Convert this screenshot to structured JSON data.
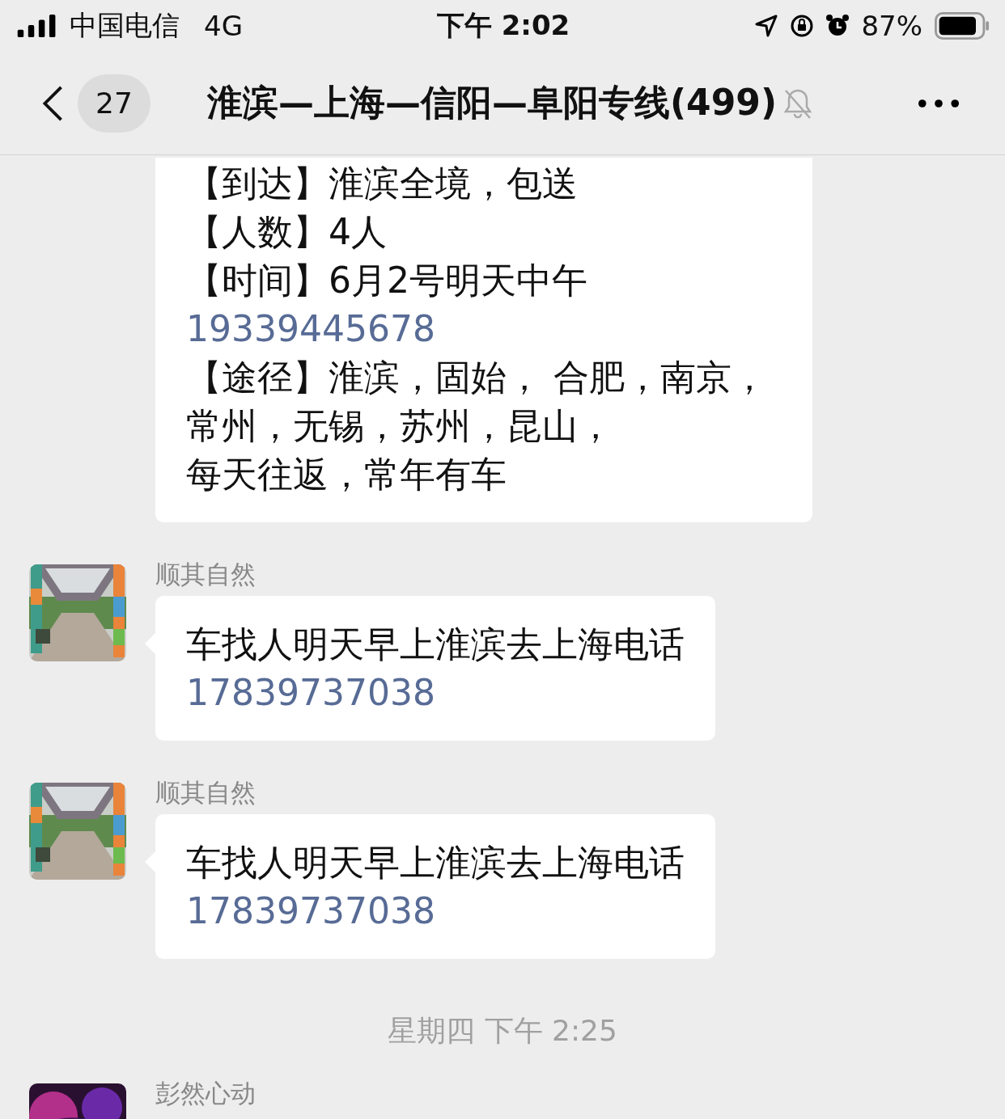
{
  "status_bar": {
    "carrier": "中国电信",
    "network": "4G",
    "time": "下午 2:02",
    "battery": "87%"
  },
  "header": {
    "back_badge": "27",
    "title": "淮滨—上海—信阳—阜阳专线(499)",
    "muted": true
  },
  "messages": [
    {
      "kind": "message",
      "lines": [
        {
          "kind": "text",
          "text": "【到达】淮滨全境，包送"
        },
        {
          "kind": "text",
          "text": "【人数】4人"
        },
        {
          "kind": "text",
          "text": "【时间】6月2号明天中午"
        },
        {
          "kind": "phone",
          "text": "19339445678"
        },
        {
          "kind": "text",
          "text": "【途径】淮滨，固始， 合肥，南京，"
        },
        {
          "kind": "text",
          "text": "常州，无锡，苏州，昆山，"
        },
        {
          "kind": "text",
          "text": "每天往返，常年有车"
        }
      ]
    },
    {
      "kind": "message",
      "sender": "顺其自然",
      "lines": [
        {
          "kind": "text",
          "text": "车找人明天早上淮滨去上海电话"
        },
        {
          "kind": "phone",
          "text": "17839737038"
        }
      ]
    },
    {
      "kind": "message",
      "sender": "顺其自然",
      "lines": [
        {
          "kind": "text",
          "text": "车找人明天早上淮滨去上海电话"
        },
        {
          "kind": "phone",
          "text": "17839737038"
        }
      ]
    },
    {
      "kind": "timestamp",
      "text": "星期四 下午 2:25"
    },
    {
      "kind": "message",
      "sender": "彭然心动"
    }
  ]
}
